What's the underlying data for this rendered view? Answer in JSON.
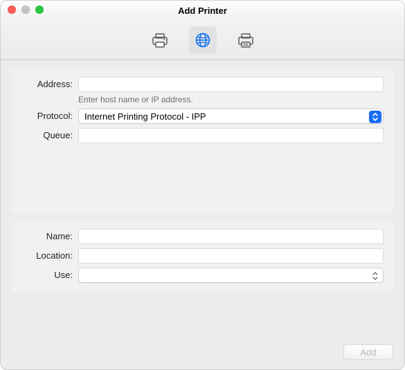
{
  "window": {
    "title": "Add Printer"
  },
  "toolbar": {
    "modes": {
      "default": "default-mode",
      "ip": "ip-mode",
      "windows": "windows-mode"
    },
    "selected": "ip"
  },
  "form": {
    "address": {
      "label": "Address:",
      "value": "",
      "hint": "Enter host name or IP address."
    },
    "protocol": {
      "label": "Protocol:",
      "value": "Internet Printing Protocol - IPP"
    },
    "queue": {
      "label": "Queue:",
      "value": "",
      "hint": ""
    },
    "name": {
      "label": "Name:",
      "value": ""
    },
    "location": {
      "label": "Location:",
      "value": ""
    },
    "use": {
      "label": "Use:",
      "value": ""
    }
  },
  "footer": {
    "add_label": "Add",
    "add_enabled": false
  },
  "colors": {
    "accent": "#1a6cf8"
  }
}
